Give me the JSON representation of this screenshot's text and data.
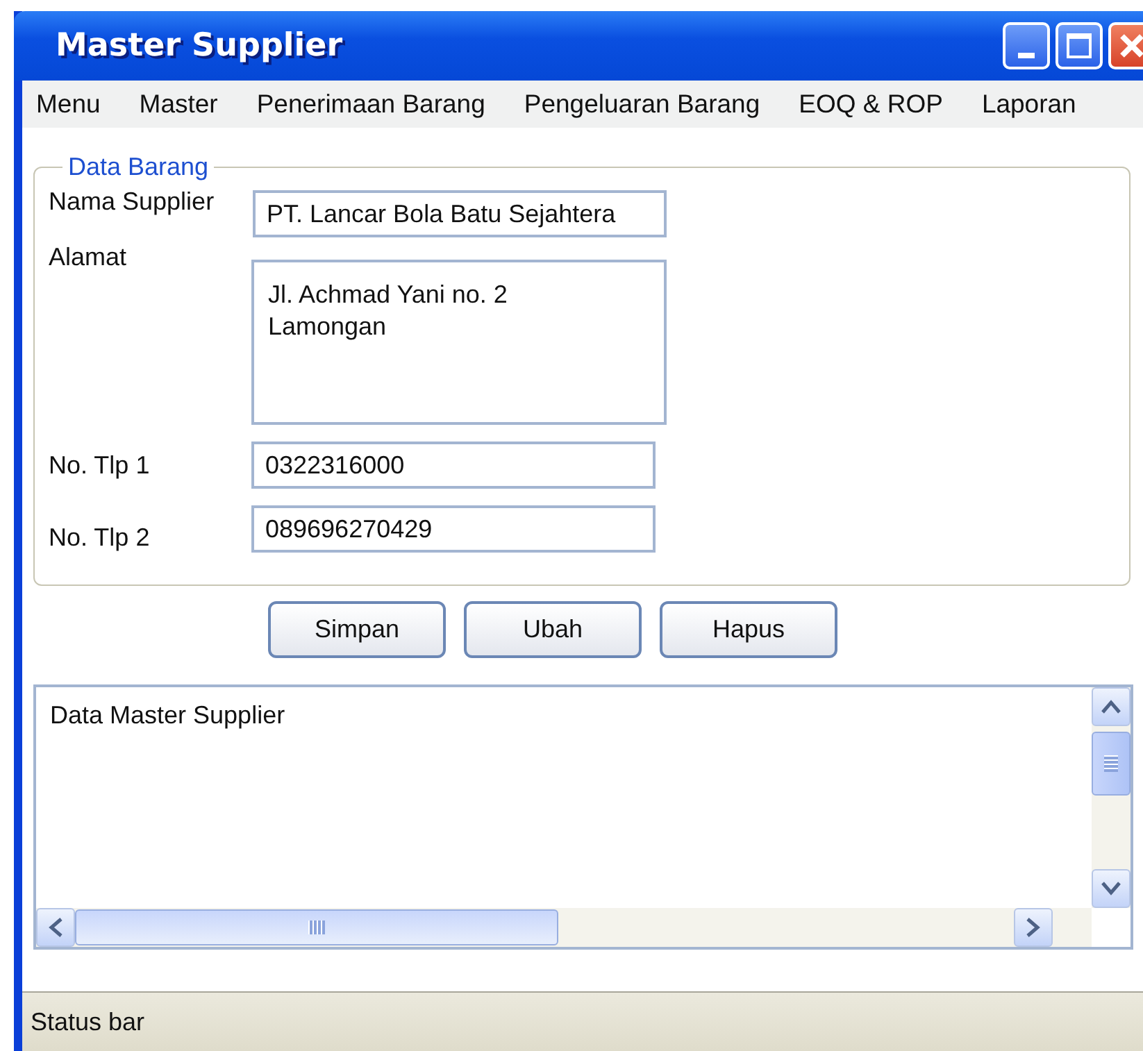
{
  "window": {
    "title": "Master Supplier"
  },
  "menu": [
    {
      "label": "Menu"
    },
    {
      "label": "Master"
    },
    {
      "label": "Penerimaan Barang"
    },
    {
      "label": "Pengeluaran Barang"
    },
    {
      "label": "EOQ & ROP"
    },
    {
      "label": "Laporan"
    }
  ],
  "data_barang": {
    "legend": "Data Barang",
    "fields": [
      {
        "kind": "input",
        "label": "Nama Supplier",
        "value": "PT. Lancar Bola Batu Sejahtera"
      },
      {
        "kind": "textarea",
        "label": "Alamat",
        "value": "Jl. Achmad Yani no. 2\nLamongan"
      },
      {
        "kind": "input",
        "label": "No. Tlp 1",
        "value": "0322316000"
      },
      {
        "kind": "input",
        "label": "No. Tlp 2",
        "value": "089696270429"
      }
    ]
  },
  "buttons": [
    {
      "label": "Simpan"
    },
    {
      "label": "Ubah"
    },
    {
      "label": "Hapus"
    }
  ],
  "list": {
    "title": "Data Master Supplier"
  },
  "status_bar": "Status bar"
}
